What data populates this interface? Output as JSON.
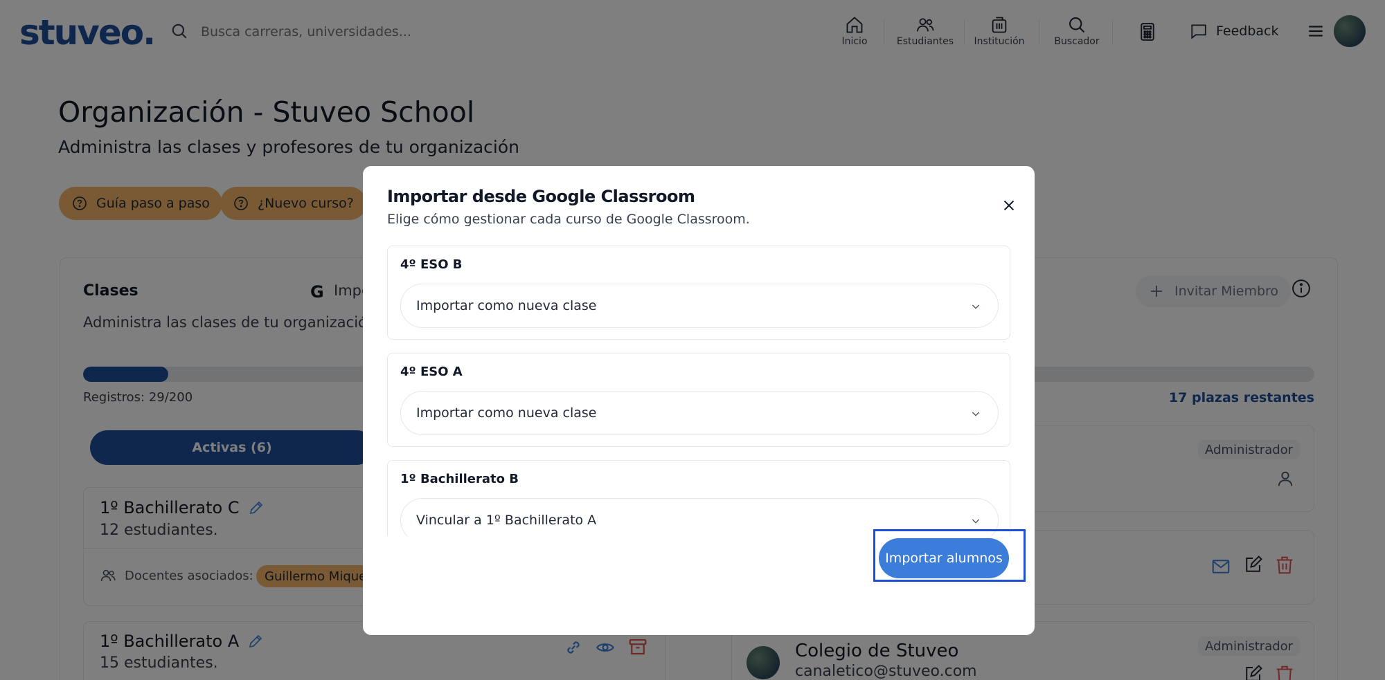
{
  "topbar": {
    "logo": "stuveo.",
    "search_placeholder": "Busca carreras, universidades...",
    "nav": [
      "Inicio",
      "Estudiantes",
      "Institución",
      "Buscador"
    ],
    "feedback": "Feedback"
  },
  "page": {
    "title": "Organización - Stuveo School",
    "subtitle": "Administra las clases y profesores de tu organización",
    "guide_button": "Guía paso a paso",
    "new_course_button": "¿Nuevo curso?"
  },
  "classes": {
    "title": "Clases",
    "import_label": "Impo",
    "description": "Administra las clases de tu organización",
    "progress_fraction": 0.069,
    "registros": "Registros: 29/200",
    "plazas": "17 plazas restantes",
    "tab_active": "Activas (6)",
    "items": [
      {
        "name": "1º Bachillerato C",
        "count": "12 estudiantes.",
        "teachers_label": "Docentes asociados:",
        "teacher": "Guillermo Miquel"
      },
      {
        "name": "1º Bachillerato A",
        "count": "15 estudiantes."
      }
    ]
  },
  "members": {
    "invite_button": "Invitar Miembro",
    "role_admin": "Administrador",
    "member_name": "Colegio de Stuveo",
    "member_email": "canaletico@stuveo.com"
  },
  "modal": {
    "title": "Importar desde Google Classroom",
    "subtitle": "Elige cómo gestionar cada curso de Google Classroom.",
    "courses": [
      {
        "label": "4º ESO B",
        "selection": "Importar como nueva clase"
      },
      {
        "label": "4º ESO A",
        "selection": "Importar como nueva clase"
      },
      {
        "label": "1º Bachillerato B",
        "selection": "Vincular a 1º Bachillerato A"
      }
    ],
    "import_button": "Importar alumnos"
  }
}
